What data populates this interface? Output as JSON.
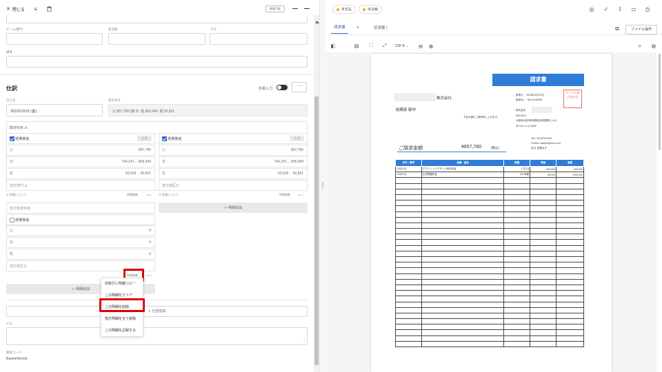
{
  "topbar": {
    "close_label": "閉じる",
    "edit_badge": "編集可能",
    "status_unpaid": "未支払",
    "status_unapproved": "未決裁",
    "file_ops": "ファイル操作"
  },
  "fields_top": {
    "team_label": "チーム/部門",
    "owner_label": "担当者",
    "tag_label": "タグ",
    "note_label": "備考"
  },
  "journal": {
    "title": "仕訳",
    "foreign_label": "外貨入力",
    "date_label": "計上日",
    "date_value": "2023/12/15 (金)",
    "total_label": "借方合計",
    "total_text": "込 857,780 (税 0)",
    "total_ex": "抜 806,949",
    "total_tax": "税 50,831",
    "account_label": "勘定科目 ⇄",
    "left": {
      "account": "経費推進",
      "input_btn": "入力",
      "amount": "857,780",
      "row2": "794,241→ 806,949",
      "row3": "63,539→ 50,831",
      "dept_placeholder": "借方部門 ⇄",
      "memo": "⓪ 前要について",
      "detail": "明細編集",
      "no": "No.1"
    },
    "right": {
      "account": "経費推進",
      "input_btn": "入力",
      "amount": "857,780",
      "row2": "794,241→ 806,949",
      "row3": "63,539→ 50,831",
      "dept_placeholder": "貸方部区分",
      "memo": "⓪ 前要について",
      "detail": "明細編集",
      "no": "No.1",
      "add_btn": "＋ 明細追加"
    },
    "second": {
      "account_placeholder": "借方勘定科目",
      "account": "経費推進",
      "v1": "0",
      "v2": "0",
      "v3": "0",
      "dept_placeholder": "借方部区分",
      "detail": "明細編集",
      "no": "No.2",
      "add_btn": "＋ 明細追加"
    },
    "journal_add": "＋ 仕訳追加",
    "memo_label": "メモ",
    "code_label": "要素コード",
    "code_value": "Bueimmkmuh"
  },
  "context_menu": {
    "items": [
      "前後行に明細コピー",
      "この明細をクリア",
      "この明細を削除",
      "借方明細を全て削除",
      "この明細を記録する"
    ]
  },
  "viewer": {
    "tab_invoice": "請求書",
    "tab_plus": "＋",
    "tab_receipt": "受領書 (",
    "zoom": "128 % ⌄"
  },
  "invoice": {
    "title": "請求書",
    "company_suffix": "株式会社",
    "to_line": "総務部 御中",
    "greeting": "下記の通りご請求申し上げます。",
    "issue_date": "請求日:　2023年12月31日",
    "invoice_no": "請求No.:　INV12109993",
    "seal": "サンプル株式会社印",
    "issuer": [
      "株式会社",
      "545-0016",
      "大阪府大阪市阿倍野区阿倍野筋1-1-43",
      "あべのハルカス50F"
    ],
    "contact": [
      "TEL: 06-6978-6432",
      "E-MAIL: sample@xxxx.com",
      "担当: 営業太子"
    ],
    "amount_label": "ご請求金額",
    "amount_value": "¥857,780",
    "amount_note": "(税込)",
    "headers": [
      "日付・番号",
      "品番・品名",
      "数量",
      "単価",
      "金額"
    ],
    "rows": [
      [
        "12月31日",
        "グラフィックデザイン制作料金",
        "1",
        "式 [1]",
        "¥39,500",
        "¥39,500"
      ],
      [
        "12月31日",
        "広告掲載料金",
        "150",
        "時間",
        "¥5,000",
        "¥750,000"
      ]
    ]
  },
  "colors": {
    "accent": "#2f64c8",
    "invoice_blue": "#2f7dd8",
    "highlight": "#e00000"
  }
}
